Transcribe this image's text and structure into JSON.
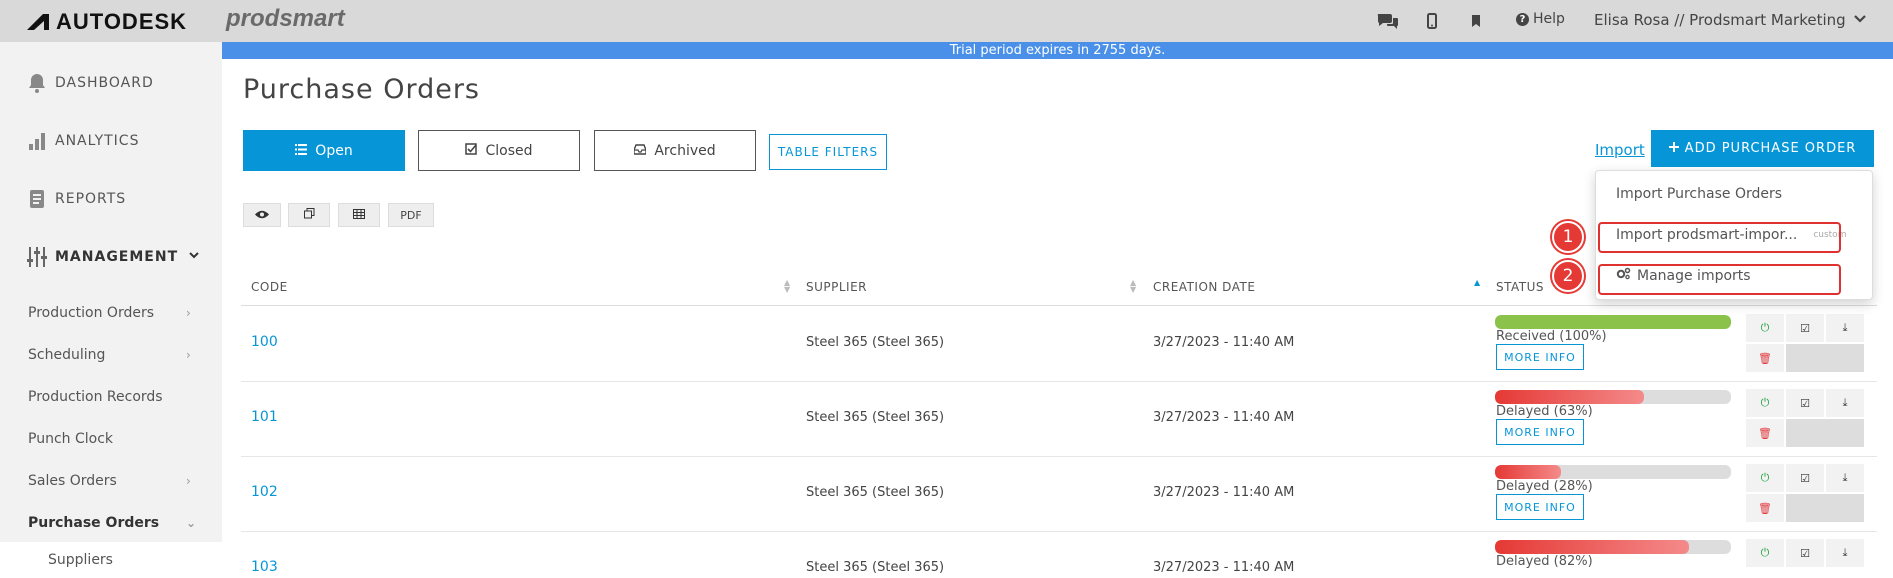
{
  "topbar": {
    "brand": "AUTODESK",
    "product": "prodsmart",
    "help_label": "Help",
    "user_label": "Elisa Rosa // Prodsmart Marketing"
  },
  "banner": {
    "text": "Trial period expires in 2755 days."
  },
  "sidebar": {
    "main": [
      {
        "label": "DASHBOARD",
        "icon": "bell-icon"
      },
      {
        "label": "ANALYTICS",
        "icon": "bar-chart-icon"
      },
      {
        "label": "REPORTS",
        "icon": "document-icon"
      },
      {
        "label": "MANAGEMENT",
        "icon": "sliders-icon"
      }
    ],
    "sub": [
      {
        "label": "Production Orders",
        "has_chevron": true
      },
      {
        "label": "Scheduling",
        "has_chevron": true
      },
      {
        "label": "Production Records",
        "has_chevron": false
      },
      {
        "label": "Punch Clock",
        "has_chevron": false
      },
      {
        "label": "Sales Orders",
        "has_chevron": true
      },
      {
        "label": "Purchase Orders",
        "has_chevron": true,
        "active": true
      }
    ],
    "subsub": [
      {
        "label": "Suppliers"
      }
    ]
  },
  "main": {
    "title": "Purchase Orders",
    "tabs": [
      {
        "label": "Open",
        "icon": "list-icon",
        "active": true
      },
      {
        "label": "Closed",
        "icon": "check-square-icon"
      },
      {
        "label": "Archived",
        "icon": "inbox-icon"
      }
    ],
    "table_filters_label": "TABLE FILTERS",
    "import_label": "Import",
    "add_label": "ADD PURCHASE ORDER",
    "tool_buttons": [
      {
        "name": "eye",
        "label": ""
      },
      {
        "name": "copy",
        "label": ""
      },
      {
        "name": "table",
        "label": ""
      },
      {
        "name": "pdf",
        "label": "PDF"
      }
    ]
  },
  "dropdown": {
    "items": [
      {
        "label": "Import Purchase Orders"
      },
      {
        "label": "Import prodsmart-impor...",
        "tag": "custom"
      },
      {
        "label": "Manage imports",
        "icon": "gears-icon"
      }
    ],
    "callouts": [
      "1",
      "2"
    ]
  },
  "table": {
    "columns": [
      "CODE",
      "SUPPLIER",
      "CREATION DATE",
      "STATUS"
    ],
    "more_info_label": "MORE INFO",
    "rows": [
      {
        "code": "100",
        "supplier": "Steel 365 (Steel 365)",
        "date": "3/27/2023 - 11:40 AM",
        "status": "Received (100%)",
        "progress": 100,
        "color": "#8bc34a"
      },
      {
        "code": "101",
        "supplier": "Steel 365 (Steel 365)",
        "date": "3/27/2023 - 11:40 AM",
        "status": "Delayed (63%)",
        "progress": 63,
        "color": "#ef5350"
      },
      {
        "code": "102",
        "supplier": "Steel 365 (Steel 365)",
        "date": "3/27/2023 - 11:40 AM",
        "status": "Delayed (28%)",
        "progress": 28,
        "color": "#ef5350"
      },
      {
        "code": "103",
        "supplier": "Steel 365 (Steel 365)",
        "date": "3/27/2023 - 11:40 AM",
        "status": "Delayed (82%)",
        "progress": 82,
        "color": "#ef5350"
      }
    ]
  },
  "colors": {
    "accent": "#0696d7",
    "banner": "#4a90e8",
    "callout": "#e53935"
  }
}
